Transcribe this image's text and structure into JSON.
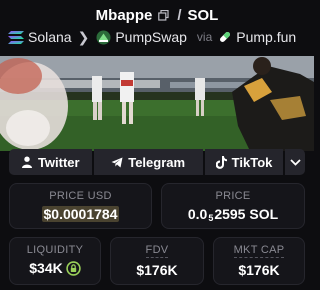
{
  "header": {
    "token_symbol": "Mbappe",
    "separator": "/",
    "quote_symbol": "SOL",
    "chain": "Solana",
    "dex": "PumpSwap",
    "via_label": "via",
    "launchpad": "Pump.fun"
  },
  "banner": {
    "description_icon": "soccer-player-photo"
  },
  "socials": {
    "twitter": "Twitter",
    "telegram": "Telegram",
    "tiktok": "TikTok"
  },
  "stats": {
    "price_usd_label": "PRICE USD",
    "price_usd_value": "$0.0001784",
    "price_sol_label": "PRICE",
    "price_sol_prefix": "0.0",
    "price_sol_zeros": "5",
    "price_sol_digits": "2595",
    "price_sol_unit": "SOL",
    "liquidity_label": "LIQUIDITY",
    "liquidity_value": "$34K",
    "fdv_label": "FDV",
    "fdv_value": "$176K",
    "mcap_label": "MKT CAP",
    "mcap_value": "$176K"
  },
  "colors": {
    "background": "#0d0d10",
    "card": "#15151a",
    "lock_green": "#9bd15a",
    "highlight": "#4a4330"
  }
}
